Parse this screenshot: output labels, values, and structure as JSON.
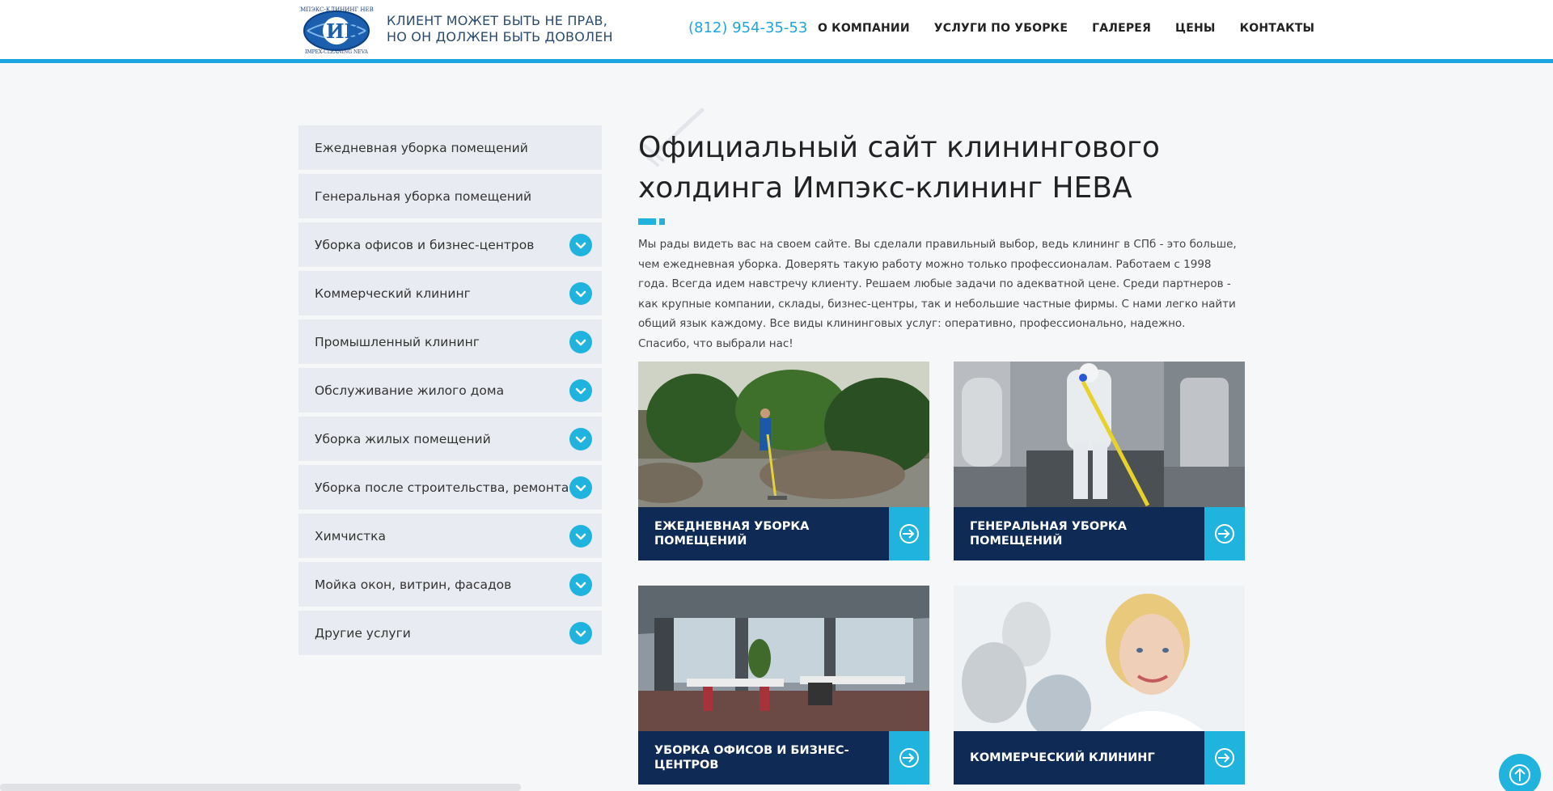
{
  "header": {
    "tagline_line1": "КЛИЕНТ МОЖЕТ БЫТЬ НЕ ПРАВ,",
    "tagline_line2": "НО ОН ДОЛЖЕН БЫТЬ ДОВОЛЕН",
    "phone": "(812) 954-35-53",
    "logo_text_top": "ИМПЭКС-КЛИНИНГ НЕВА",
    "logo_text_bottom": "IMPEX-CLEANING NEVA",
    "nav": [
      "О КОМПАНИИ",
      "УСЛУГИ ПО УБОРКЕ",
      "ГАЛЕРЕЯ",
      "ЦЕНЫ",
      "КОНТАКТЫ"
    ]
  },
  "sidebar": {
    "items": [
      {
        "label": "Ежедневная уборка помещений",
        "expandable": false
      },
      {
        "label": "Генеральная уборка помещений",
        "expandable": false
      },
      {
        "label": "Уборка офисов и бизнес-центров",
        "expandable": true
      },
      {
        "label": "Коммерческий клининг",
        "expandable": true
      },
      {
        "label": "Промышленный клининг",
        "expandable": true
      },
      {
        "label": "Обслуживание жилого дома",
        "expandable": true
      },
      {
        "label": "Уборка жилых помещений",
        "expandable": true
      },
      {
        "label": "Уборка после строительства, ремонта",
        "expandable": true
      },
      {
        "label": "Химчистка",
        "expandable": true
      },
      {
        "label": "Мойка окон, витрин, фасадов",
        "expandable": true
      },
      {
        "label": "Другие услуги",
        "expandable": true
      }
    ]
  },
  "main": {
    "title": "Официальный сайт клинингового холдинга Импэкс-клининг НЕВА",
    "intro": "Мы рады видеть вас на своем сайте. Вы сделали правильный выбор, ведь клининг в СПб - это больше, чем ежедневная уборка. Доверять такую работу можно только профессионалам. Работаем с 1998 года. Всегда идем навстречу клиенту. Решаем любые задачи по адекватной цене. Среди партнеров - как крупные компании, склады, бизнес-центры, так и небольшие частные фирмы. С нами легко найти общий язык каждому. Все виды клининговых услуг: оперативно, профессионально, надежно. Спасибо, что выбрали нас!"
  },
  "cards": [
    {
      "caption": "ЕЖЕДНЕВНАЯ УБОРКА ПОМЕЩЕНИЙ"
    },
    {
      "caption": "ГЕНЕРАЛЬНАЯ УБОРКА ПОМЕЩЕНИЙ"
    },
    {
      "caption": "УБОРКА ОФИСОВ И БИЗНЕС-ЦЕНТРОВ"
    },
    {
      "caption": "КОММЕРЧЕСКИЙ КЛИНИНГ"
    }
  ],
  "colors": {
    "accent": "#1fb3dd",
    "navy": "#0e2a55",
    "header_border": "#1da5e0",
    "menu_bg": "#e8ecf2"
  }
}
